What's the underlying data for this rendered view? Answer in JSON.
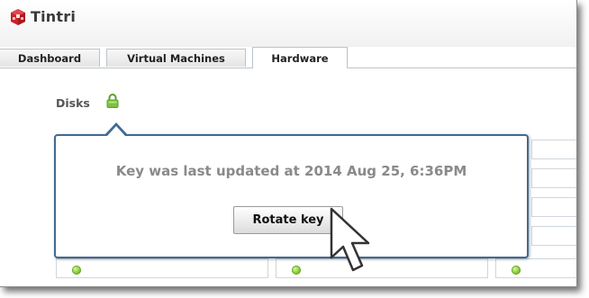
{
  "app": {
    "brand": "Tintri"
  },
  "tabs": [
    {
      "label": "Dashboard",
      "active": false
    },
    {
      "label": "Virtual Machines",
      "active": false
    },
    {
      "label": "Hardware",
      "active": true
    }
  ],
  "disks": {
    "label": "Disks",
    "lock_icon": "lock-icon",
    "lock_color": "#7cc241"
  },
  "popup": {
    "message": "Key was last updated at 2014 Aug 25, 6:36PM",
    "button_label": "Rotate key"
  },
  "colors": {
    "popup_border": "#3f6a95",
    "status_ok": "#7dc62a",
    "logo_red": "#cc2229"
  }
}
